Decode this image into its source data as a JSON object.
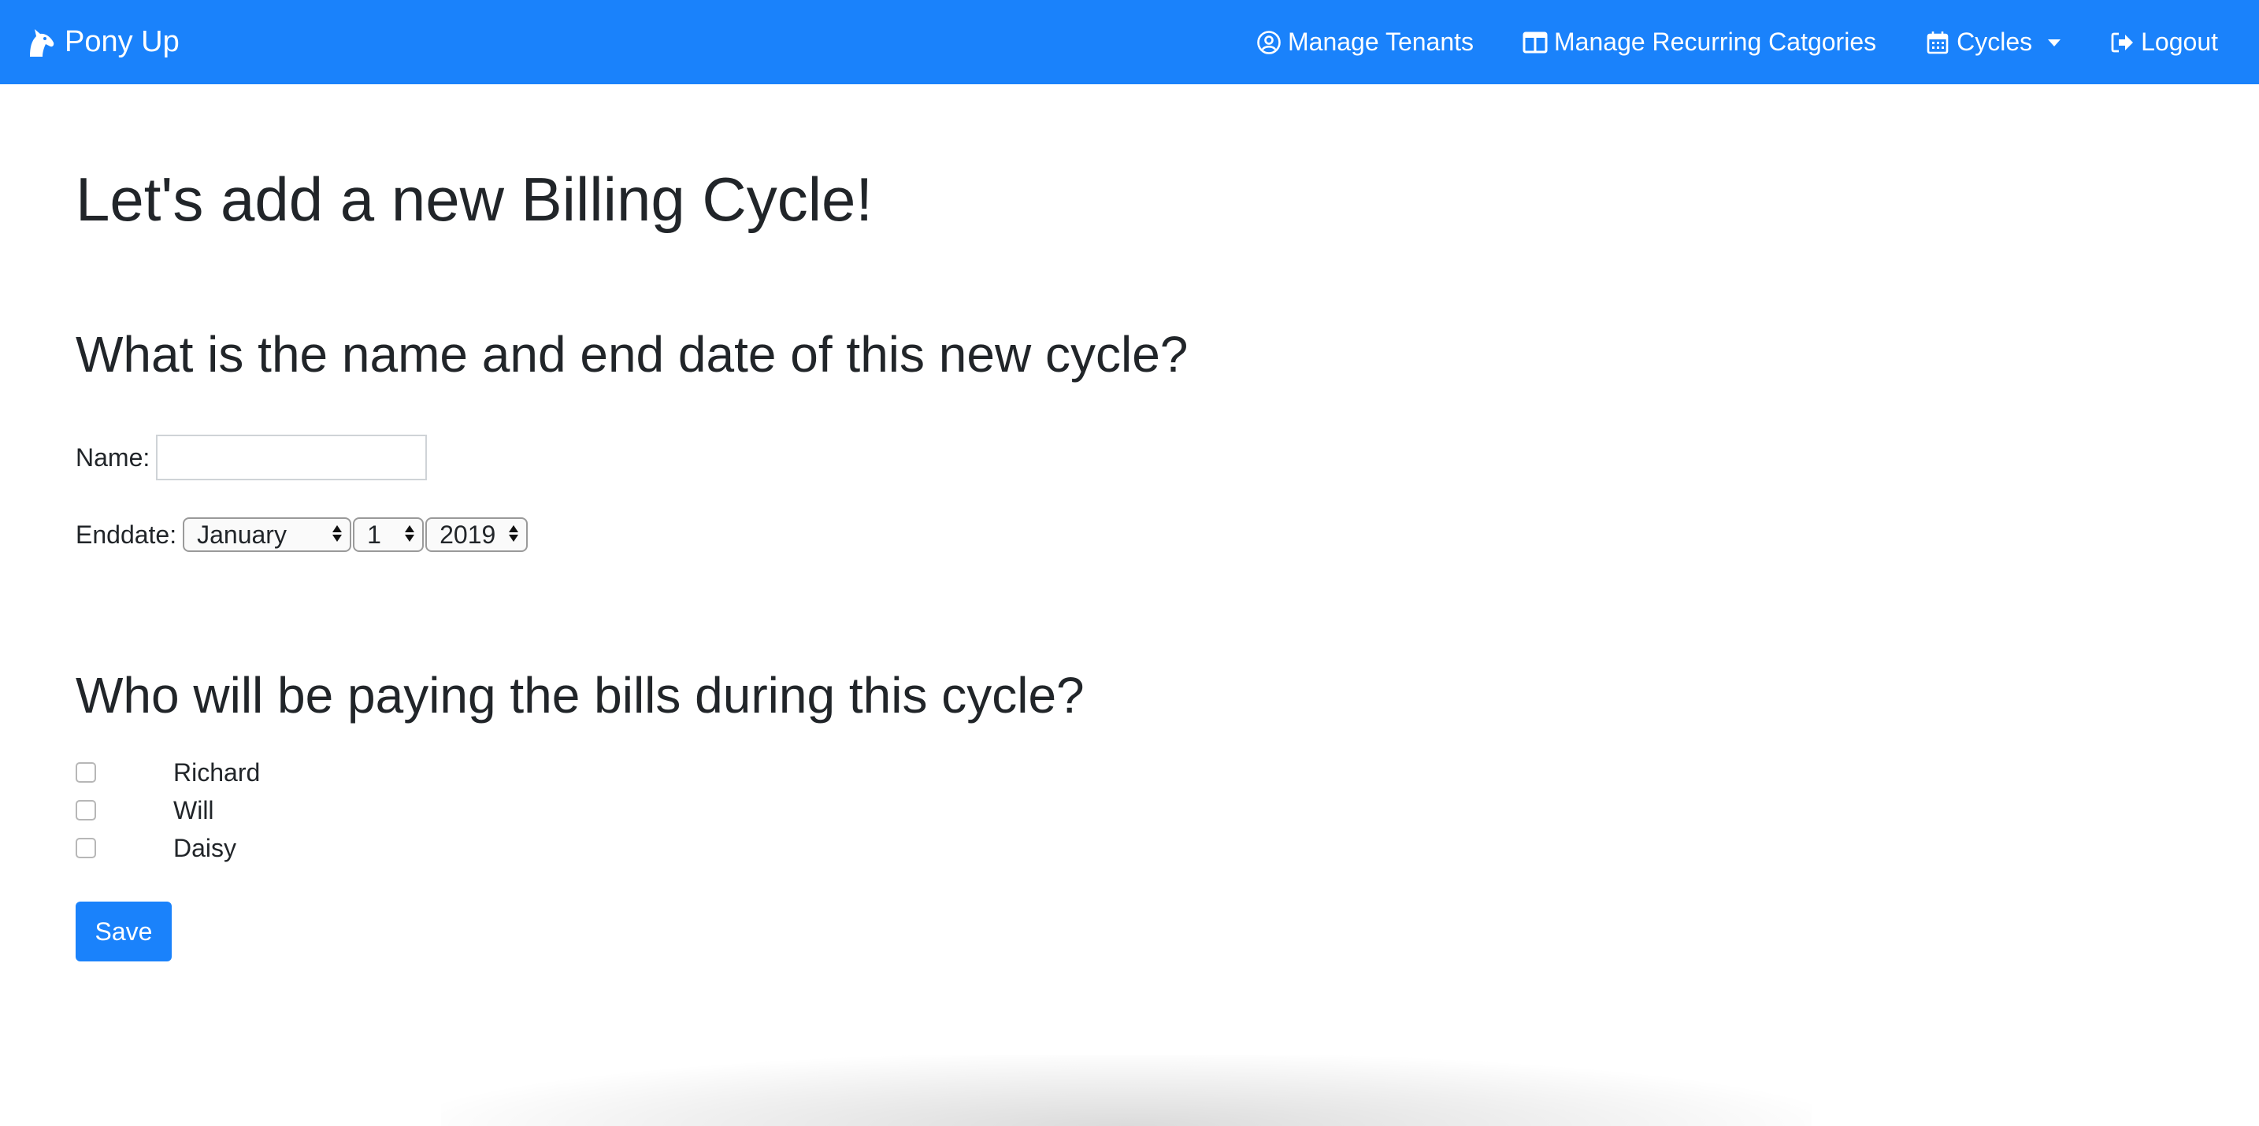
{
  "navbar": {
    "brand": "Pony Up",
    "brand_icon": "horse-head-icon",
    "items": [
      {
        "label": "Manage Tenants",
        "icon": "user-circle-icon"
      },
      {
        "label": "Manage Recurring Catgories",
        "icon": "columns-icon"
      },
      {
        "label": "Cycles",
        "icon": "calendar-icon"
      },
      {
        "label": "Logout",
        "icon": "sign-out-icon"
      }
    ]
  },
  "page": {
    "title": "Let's add a new Billing Cycle!"
  },
  "cycle_section": {
    "title": "What is the name and end date of this new cycle?",
    "name_label": "Name:",
    "name_value": "",
    "enddate_label": "Enddate:",
    "month": "January",
    "day": "1",
    "year": "2019"
  },
  "tenant_section": {
    "title": "Who will be paying the bills during this cycle?",
    "tenants": [
      {
        "name": "Richard",
        "checked": false
      },
      {
        "name": "Will",
        "checked": false
      },
      {
        "name": "Daisy",
        "checked": false
      }
    ]
  },
  "actions": {
    "save_label": "Save"
  },
  "colors": {
    "primary": "#1a82fb",
    "text": "#212529"
  }
}
